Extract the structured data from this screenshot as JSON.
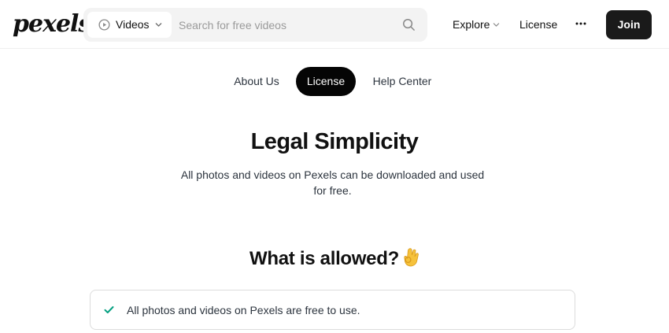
{
  "header": {
    "logo": "pexels",
    "search": {
      "type_label": "Videos",
      "placeholder": "Search for free videos"
    },
    "nav": {
      "explore": "Explore",
      "license": "License"
    },
    "join_label": "Join"
  },
  "tabs": [
    {
      "label": "About Us",
      "active": false
    },
    {
      "label": "License",
      "active": true
    },
    {
      "label": "Help Center",
      "active": false
    }
  ],
  "hero": {
    "title": "Legal Simplicity",
    "description": "All photos and videos on Pexels can be downloaded and used for free."
  },
  "allowed": {
    "title": "What is allowed?",
    "emoji_icon": "ok-hand-emoji",
    "items": [
      {
        "icon": "check-icon",
        "text": "All photos and videos on Pexels are free to use."
      }
    ]
  },
  "colors": {
    "accent_dark": "#050505",
    "check_green": "#05a081",
    "search_bg": "#f3f3f3"
  }
}
